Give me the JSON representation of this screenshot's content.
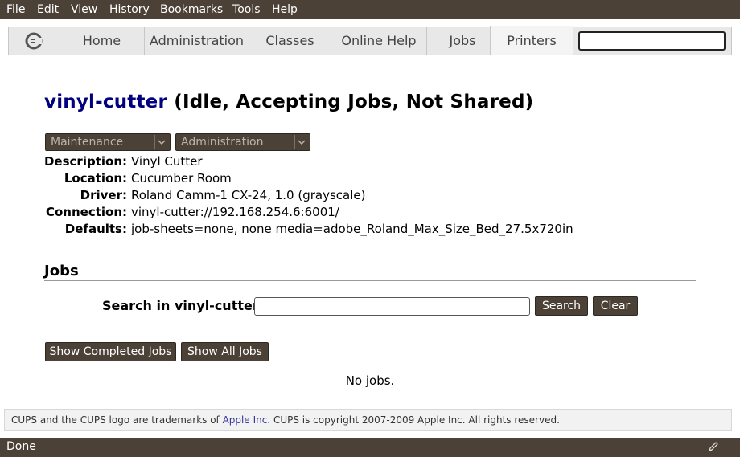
{
  "menu": [
    {
      "accel": "F",
      "rest": "ile"
    },
    {
      "accel": "E",
      "rest": "dit"
    },
    {
      "accel": "V",
      "rest": "iew"
    },
    {
      "pre": "Hi",
      "accel": "s",
      "rest": "tory"
    },
    {
      "accel": "B",
      "rest": "ookmarks"
    },
    {
      "accel": "T",
      "rest": "ools"
    },
    {
      "accel": "H",
      "rest": "elp"
    }
  ],
  "nav": {
    "tabs": [
      "Home",
      "Administration",
      "Classes",
      "Online Help",
      "Jobs",
      "Printers"
    ],
    "active": "Printers",
    "search_value": ""
  },
  "printer": {
    "name": "vinyl-cutter",
    "state": "(Idle, Accepting Jobs, Not Shared)",
    "maintenance_select": "Maintenance",
    "administration_select": "Administration",
    "details": [
      {
        "key": "Description:",
        "value": "Vinyl Cutter"
      },
      {
        "key": "Location:",
        "value": "Cucumber Room"
      },
      {
        "key": "Driver:",
        "value": "Roland Camm-1 CX-24, 1.0 (grayscale)"
      },
      {
        "key": "Connection:",
        "value": "vinyl-cutter://192.168.254.6:6001/"
      },
      {
        "key": "Defaults:",
        "value": "job-sheets=none, none media=adobe_Roland_Max_Size_Bed_27.5x720in"
      }
    ]
  },
  "jobs": {
    "heading": "Jobs",
    "search_label": "Search in vinyl-cutter:",
    "search_value": "",
    "search_button": "Search",
    "clear_button": "Clear",
    "show_completed": "Show Completed Jobs",
    "show_all": "Show All Jobs",
    "empty_message": "No jobs."
  },
  "footer": {
    "pre": "CUPS and the CUPS logo are trademarks of ",
    "link": "Apple Inc.",
    "post": " CUPS is copyright 2007-2009 Apple Inc. All rights reserved."
  },
  "status": {
    "text": "Done"
  },
  "colors": {
    "chrome": "#4c4137",
    "title_link": "#000080"
  }
}
